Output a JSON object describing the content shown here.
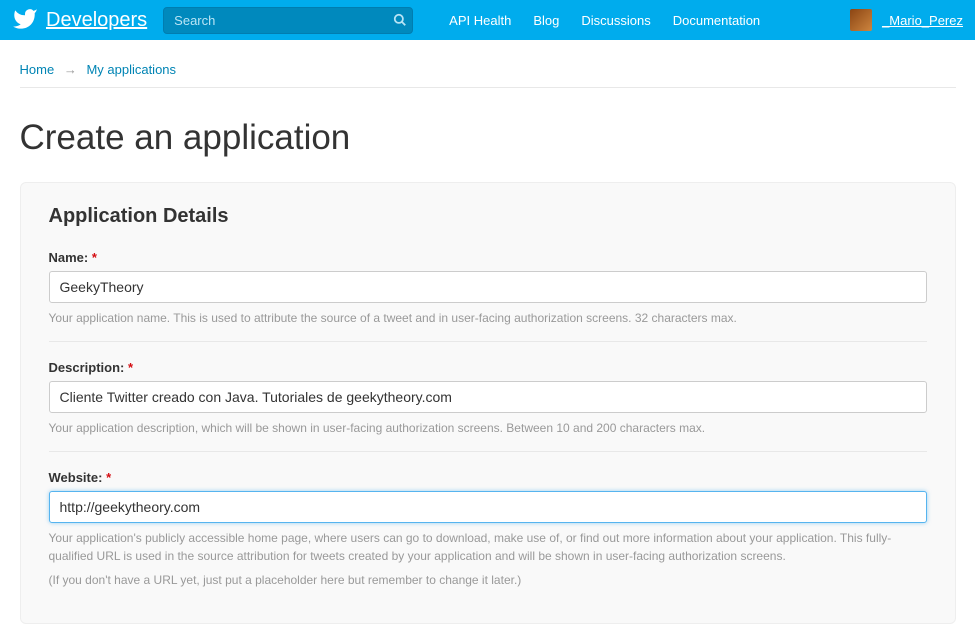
{
  "topbar": {
    "brand": "Developers",
    "search_placeholder": "Search",
    "nav": {
      "api_health": "API Health",
      "blog": "Blog",
      "discussions": "Discussions",
      "documentation": "Documentation"
    },
    "username": "_Mario_Perez"
  },
  "breadcrumb": {
    "home": "Home",
    "arrow": "→",
    "my_applications": "My applications"
  },
  "page_title": "Create an application",
  "panel": {
    "heading": "Application Details",
    "fields": {
      "name": {
        "label": "Name:",
        "required": "*",
        "value": "GeekyTheory",
        "help": "Your application name. This is used to attribute the source of a tweet and in user-facing authorization screens. 32 characters max."
      },
      "description": {
        "label": "Description:",
        "required": "*",
        "value": "Cliente Twitter creado con Java. Tutoriales de geekytheory.com",
        "help": "Your application description, which will be shown in user-facing authorization screens. Between 10 and 200 characters max."
      },
      "website": {
        "label": "Website:",
        "required": "*",
        "value": "http://geekytheory.com",
        "help1": "Your application's publicly accessible home page, where users can go to download, make use of, or find out more information about your application. This fully-qualified URL is used in the source attribution for tweets created by your application and will be shown in user-facing authorization screens.",
        "help2": "(If you don't have a URL yet, just put a placeholder here but remember to change it later.)"
      }
    }
  }
}
